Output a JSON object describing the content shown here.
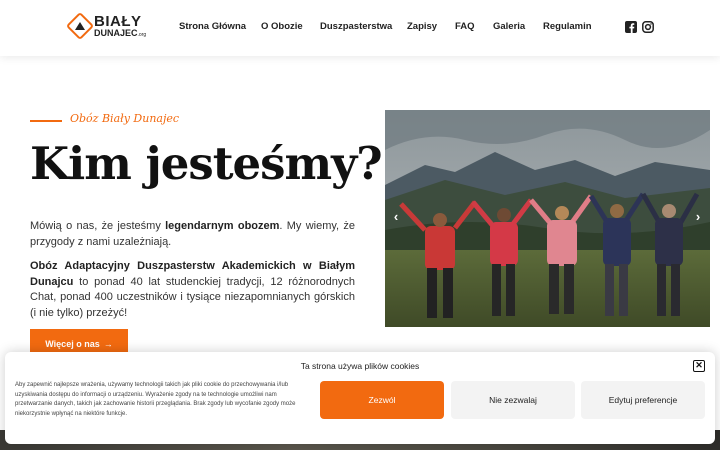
{
  "brand": {
    "name": "BIAŁY",
    "sub": "DUNAJEC",
    "sub_suffix": ".org",
    "accent": "#f26a10"
  },
  "nav": {
    "items": [
      {
        "label": "Strona Główna"
      },
      {
        "label": "O Obozie"
      },
      {
        "label": "Duszpasterstwa"
      },
      {
        "label": "Zapisy"
      },
      {
        "label": "FAQ"
      },
      {
        "label": "Galeria"
      },
      {
        "label": "Regulamin"
      }
    ],
    "social": [
      "facebook-icon",
      "instagram-icon"
    ]
  },
  "intro": {
    "tagline": "Obóz Biały Dunajec",
    "heading": "Kim jesteśmy?",
    "p1_pre": "Mówią o nas, że jesteśmy ",
    "p1_bold": "legendarnym obozem",
    "p1_post": ". My wiemy, że przygody z nami uzależniają.",
    "p2_bold": "Obóz Adaptacyjny Duszpasterstw Akademickich w Białym Dunajcu",
    "p2_post": " to ponad 40 lat studenckiej tradycji, 12 różnorodnych Chat, ponad 400 uczestników i tysiące niezapomnianych górskich (i nie tylko) przeżyć!",
    "cta": "Więcej o nas",
    "cta_arrow": "→"
  },
  "gallery": {
    "prev": "‹",
    "next": "›"
  },
  "cookie": {
    "title": "Ta strona używa plików cookies",
    "text": "Aby zapewnić najlepsze wrażenia, używamy technologii takich jak pliki cookie do przechowywania i/lub uzyskiwania dostępu do informacji o urządzeniu. Wyrażenie zgody na te technologie umożliwi nam przetwarzanie danych, takich jak zachowanie historii przeglądania. Brak zgody lub wycofanie zgody może niekorzystnie wpłynąć na niektóre funkcje.",
    "accept": "Zezwól",
    "deny": "Nie zezwalaj",
    "prefs": "Edytuj preferencje",
    "close": "✕"
  }
}
